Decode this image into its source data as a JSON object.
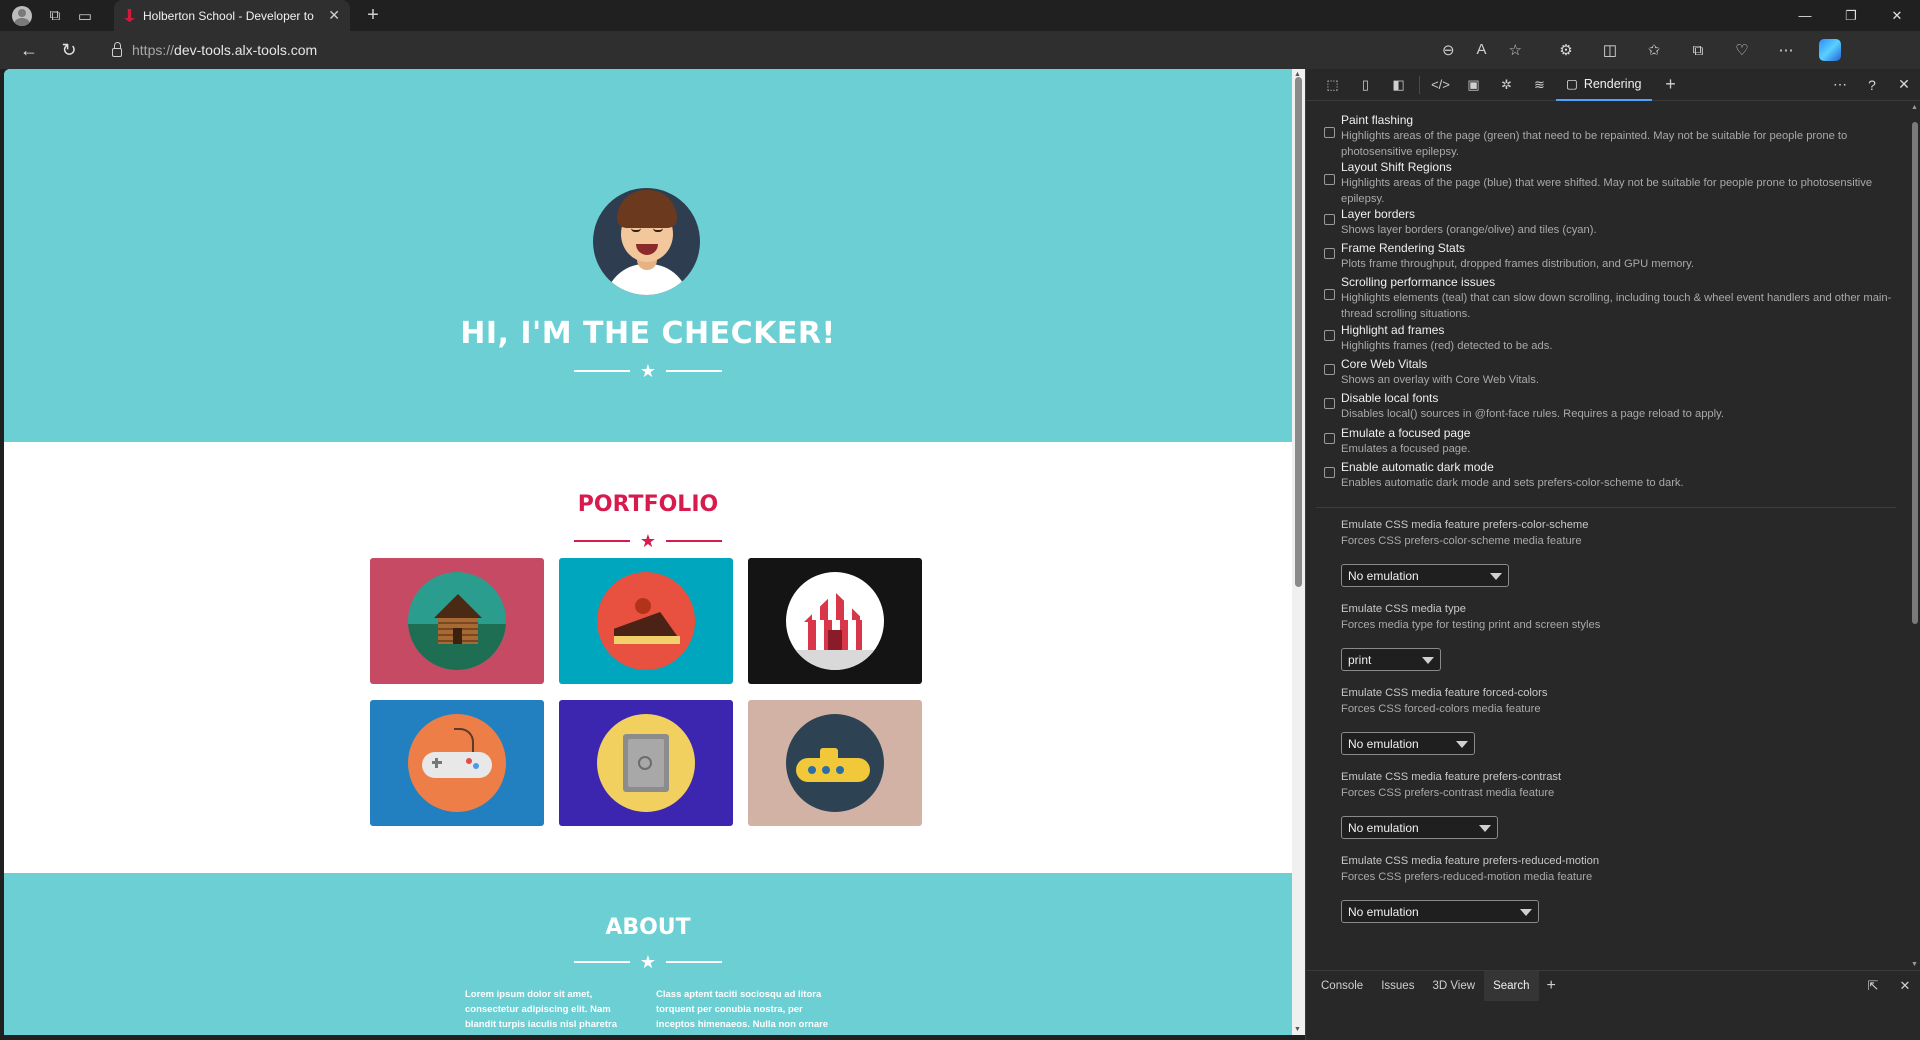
{
  "browser": {
    "tab_title": "Holberton School - Developer to",
    "url_scheme": "https://",
    "url_host": "dev-tools.alx-tools.com",
    "icons": [
      "profile-icon",
      "workspaces-icon",
      "tab-actions-icon",
      "close-icon",
      "new-tab-icon",
      "back-icon",
      "refresh-icon",
      "lock-icon",
      "zoom-icon",
      "read-aloud-icon",
      "favorite-icon",
      "extensions-icon",
      "split-screen-icon",
      "favorites-icon",
      "collections-icon",
      "browser-essentials-icon",
      "more-icon",
      "copilot-icon"
    ]
  },
  "page": {
    "hero_title": "HI, I'M THE CHECKER!",
    "portfolio_title": "PORTFOLIO",
    "about_title": "ABOUT",
    "about_col1": "Lorem ipsum dolor sit amet, consectetur adipiscing elit. Nam blandit turpis iaculis nisl pharetra auctor. Phasellus mattis",
    "about_col2": "Class aptent taciti sociosqu ad litora torquent per conubia nostra, per inceptos himenaeos. Nulla non ornare",
    "portfolio_items": [
      {
        "name": "cabin",
        "bg": "#c64a63",
        "circle": "#2a9d8f"
      },
      {
        "name": "cake",
        "bg": "#00a6bd",
        "circle": "#e8503f"
      },
      {
        "name": "circus",
        "bg": "#141414",
        "circle": "#ffffff"
      },
      {
        "name": "game-controller",
        "bg": "#2380c0",
        "circle": "#ed7e48"
      },
      {
        "name": "safe",
        "bg": "#3c26b0",
        "circle": "#f1d05f"
      },
      {
        "name": "submarine",
        "bg": "#d3b2a6",
        "circle": "#2d4252"
      }
    ],
    "colors": {
      "teal": "#6bcfd3",
      "accent": "#d81b4e"
    }
  },
  "devtools": {
    "active_tab": "Rendering",
    "options": [
      {
        "title": "Paint flashing",
        "desc": "Highlights areas of the page (green) that need to be repainted. May not be suitable for people prone to photosensitive epilepsy."
      },
      {
        "title": "Layout Shift Regions",
        "desc": "Highlights areas of the page (blue) that were shifted. May not be suitable for people prone to photosensitive epilepsy."
      },
      {
        "title": "Layer borders",
        "desc": "Shows layer borders (orange/olive) and tiles (cyan)."
      },
      {
        "title": "Frame Rendering Stats",
        "desc": "Plots frame throughput, dropped frames distribution, and GPU memory."
      },
      {
        "title": "Scrolling performance issues",
        "desc": "Highlights elements (teal) that can slow down scrolling, including touch & wheel event handlers and other main-thread scrolling situations."
      },
      {
        "title": "Highlight ad frames",
        "desc": "Highlights frames (red) detected to be ads."
      },
      {
        "title": "Core Web Vitals",
        "desc": "Shows an overlay with Core Web Vitals."
      },
      {
        "title": "Disable local fonts",
        "desc": "Disables local() sources in @font-face rules. Requires a page reload to apply."
      },
      {
        "title": "Emulate a focused page",
        "desc": "Emulates a focused page."
      },
      {
        "title": "Enable automatic dark mode",
        "desc": "Enables automatic dark mode and sets prefers-color-scheme to dark."
      }
    ],
    "emulations": [
      {
        "title": "Emulate CSS media feature prefers-color-scheme",
        "desc": "Forces CSS prefers-color-scheme media feature",
        "value": "No emulation"
      },
      {
        "title": "Emulate CSS media type",
        "desc": "Forces media type for testing print and screen styles",
        "value": "print"
      },
      {
        "title": "Emulate CSS media feature forced-colors",
        "desc": "Forces CSS forced-colors media feature",
        "value": "No emulation"
      },
      {
        "title": "Emulate CSS media feature prefers-contrast",
        "desc": "Forces CSS prefers-contrast media feature",
        "value": "No emulation"
      },
      {
        "title": "Emulate CSS media feature prefers-reduced-motion",
        "desc": "Forces CSS prefers-reduced-motion media feature",
        "value": "No emulation"
      }
    ],
    "drawer_tabs": [
      "Console",
      "Issues",
      "3D View",
      "Search"
    ],
    "drawer_active": "Search"
  }
}
